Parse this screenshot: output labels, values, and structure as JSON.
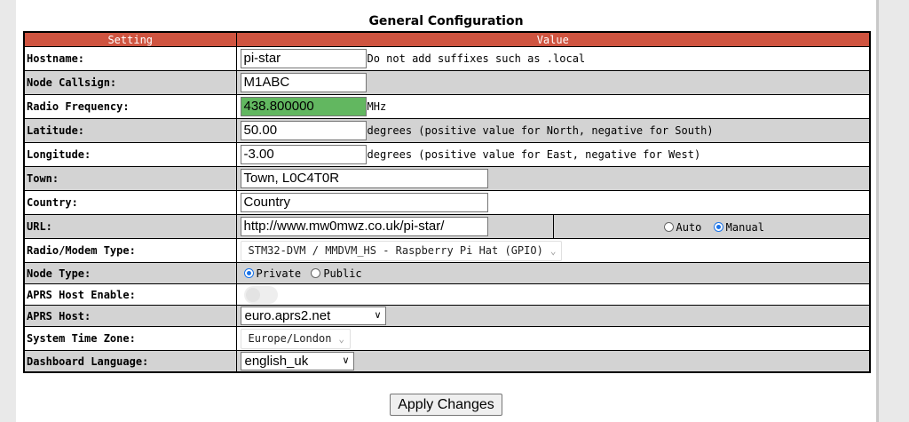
{
  "title": "General Configuration",
  "table": {
    "col_setting": "Setting",
    "col_value": "Value"
  },
  "hostname": {
    "label": "Hostname:",
    "value": "pi-star",
    "hint": "Do not add suffixes such as .local"
  },
  "callsign": {
    "label": "Node Callsign:",
    "value": "M1ABC"
  },
  "frequency": {
    "label": "Radio Frequency:",
    "value": "438.800000",
    "unit": "MHz"
  },
  "latitude": {
    "label": "Latitude:",
    "value": "50.00",
    "hint": "degrees (positive value for North, negative for South)"
  },
  "longitude": {
    "label": "Longitude:",
    "value": "-3.00",
    "hint": "degrees (positive value for East, negative for West)"
  },
  "town": {
    "label": "Town:",
    "value": "Town, L0C4T0R"
  },
  "country": {
    "label": "Country:",
    "value": "Country"
  },
  "url": {
    "label": "URL:",
    "value": "http://www.mw0mwz.co.uk/pi-star/",
    "opt_auto": "Auto",
    "opt_manual": "Manual",
    "selected": "Manual"
  },
  "modem": {
    "label": "Radio/Modem Type:",
    "value": "STM32-DVM / MMDVM_HS - Raspberry Pi Hat (GPIO)"
  },
  "node_type": {
    "label": "Node Type:",
    "opt_private": "Private",
    "opt_public": "Public",
    "selected": "Private"
  },
  "aprs_enable": {
    "label": "APRS Host Enable:",
    "enabled": false
  },
  "aprs_host": {
    "label": "APRS Host:",
    "value": "euro.aprs2.net"
  },
  "timezone": {
    "label": "System Time Zone:",
    "value": "Europe/London"
  },
  "language": {
    "label": "Dashboard Language:",
    "value": "english_uk"
  },
  "apply_label": "Apply Changes",
  "colors": {
    "header_bg": "#cf5440",
    "row_alt": "#d3d3d3",
    "freq_highlight": "#62b760",
    "radio_on": "#1a73e8"
  },
  "icons": {
    "select_arrow": "chevron-down-icon"
  }
}
